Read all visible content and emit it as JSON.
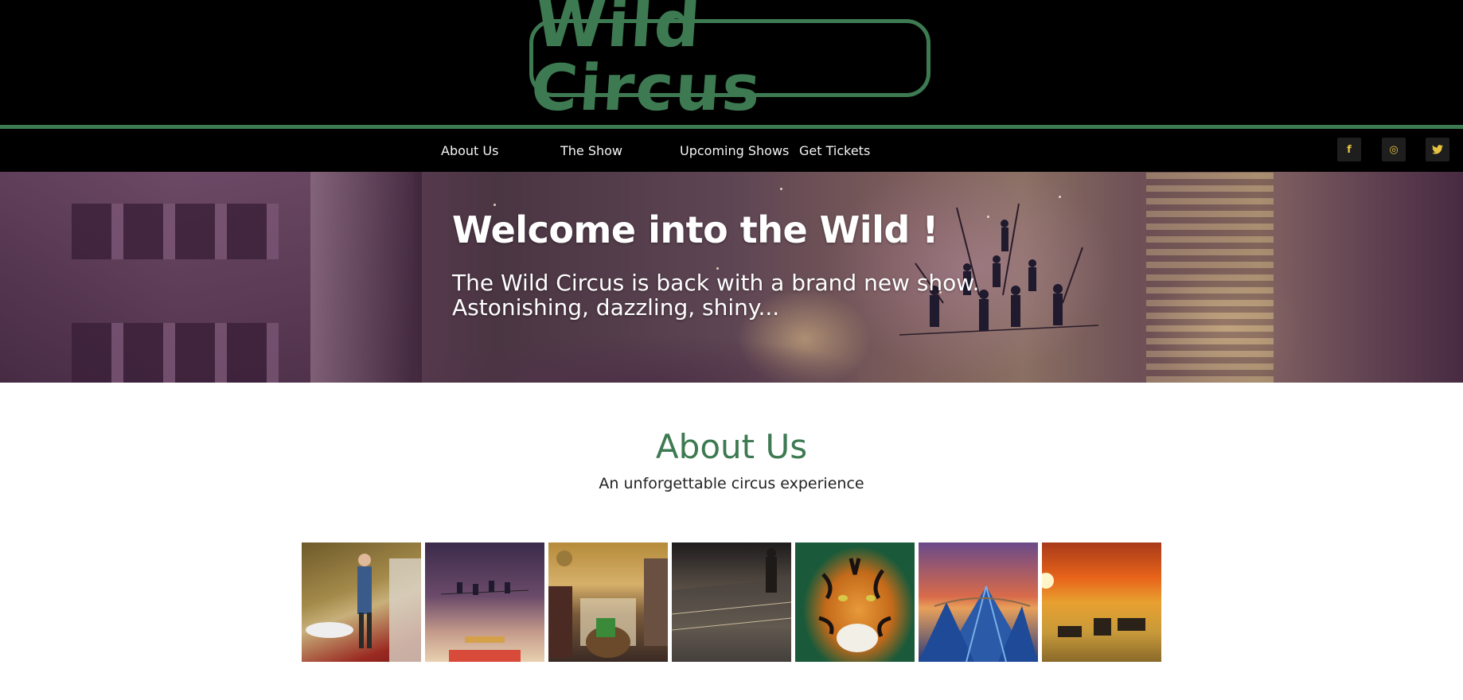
{
  "logo": {
    "text": "Wild Circus"
  },
  "nav": {
    "items": [
      {
        "label": "About Us"
      },
      {
        "label": "The Show"
      },
      {
        "label": "Upcoming Shows"
      },
      {
        "label": "Get Tickets"
      }
    ]
  },
  "social": {
    "facebook": {
      "icon": "facebook-icon",
      "glyph": "f"
    },
    "instagram": {
      "icon": "instagram-icon",
      "glyph": "◎"
    },
    "twitter": {
      "icon": "twitter-icon",
      "glyph": "🐦"
    }
  },
  "hero": {
    "title": "Welcome into the Wild !",
    "subtitle_line1": "The Wild Circus is back with a brand new show.",
    "subtitle_line2": "Astonishing, dazzling, shiny..."
  },
  "about": {
    "title": "About Us",
    "subtitle": "An unforgettable circus experience"
  },
  "gallery": {
    "images": [
      {
        "name": "acrobat-roller"
      },
      {
        "name": "tightrope-poster"
      },
      {
        "name": "animals-city"
      },
      {
        "name": "rooftop-city"
      },
      {
        "name": "tiger"
      },
      {
        "name": "circus-tents-sunset"
      },
      {
        "name": "zebras-savanna"
      }
    ]
  },
  "colors": {
    "brand_green": "#3d7a52",
    "header_bg": "#000000",
    "social_icon": "#e8c341"
  }
}
